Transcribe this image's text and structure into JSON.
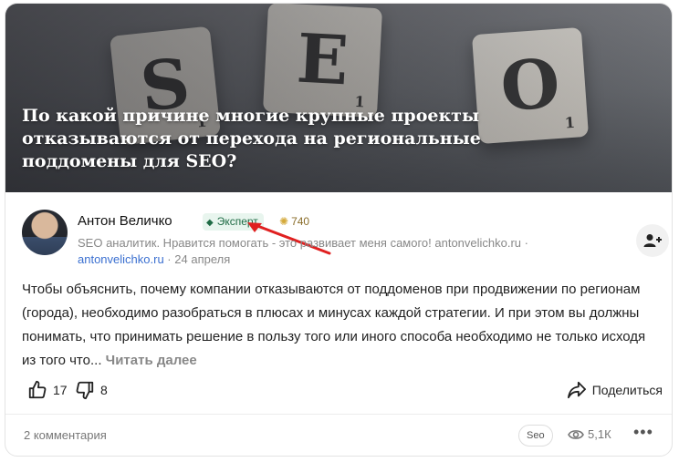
{
  "cover": {
    "title": "По какой причине многие крупные проекты отказываются от перехода на региональные поддомены для SEO?",
    "tiles": [
      "S",
      "E",
      "O"
    ],
    "tile_scores": [
      "1",
      "1",
      "1"
    ]
  },
  "author": {
    "name": "Антон Величко",
    "badge_label": "Эксперт",
    "karma": "740",
    "bio": "SEO аналитик. Нравится помогать - это развивает меня самого! antonvelichko.ru ·",
    "site_link": "antonvelichko.ru",
    "separator": "·",
    "date": "24 апреля",
    "subscribe_icon": "person-plus-icon"
  },
  "post": {
    "text": "Чтобы объяснить, почему компании отказываются от поддоменов при продвижении по регионам (города), необходимо разобраться в плюсах и минусах каждой стратегии. И при этом вы должны понимать, что принимать решение в пользу того или иного способа необходимо не только исходя из того что...",
    "read_more": "Читать далее"
  },
  "actions": {
    "likes": "17",
    "dislikes": "8",
    "share_label": "Поделиться"
  },
  "footer": {
    "comments": "2 комментария",
    "tag": "Seo",
    "views": "5,1К",
    "more_label": "•••"
  },
  "colors": {
    "badge_bg": "#e8f5ee",
    "badge_text": "#1f6b45",
    "link": "#3a6fd0",
    "arrow": "#e02020"
  }
}
